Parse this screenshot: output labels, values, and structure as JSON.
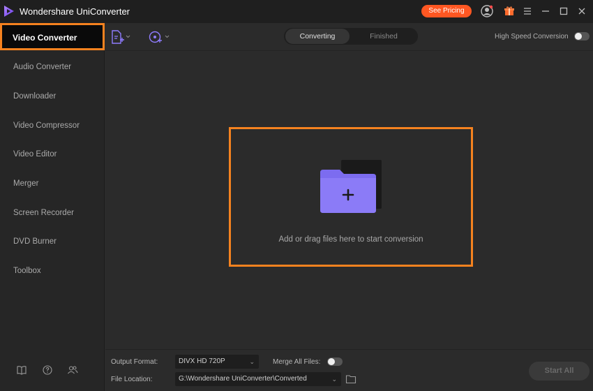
{
  "app": {
    "title": "Wondershare UniConverter",
    "see_pricing": "See Pricing"
  },
  "sidebar": {
    "items": [
      {
        "label": "Video Converter"
      },
      {
        "label": "Audio Converter"
      },
      {
        "label": "Downloader"
      },
      {
        "label": "Video Compressor"
      },
      {
        "label": "Video Editor"
      },
      {
        "label": "Merger"
      },
      {
        "label": "Screen Recorder"
      },
      {
        "label": "DVD Burner"
      },
      {
        "label": "Toolbox"
      }
    ],
    "bottom_icons": [
      "book-icon",
      "help-icon",
      "users-icon"
    ]
  },
  "toolbar": {
    "tabs": [
      {
        "label": "Converting"
      },
      {
        "label": "Finished"
      }
    ],
    "active_tab": "Converting",
    "high_speed_label": "High Speed Conversion",
    "high_speed_on": false
  },
  "dropzone": {
    "text": "Add or drag files here to start conversion"
  },
  "bottom": {
    "output_format_label": "Output Format:",
    "output_format_value": "DIVX HD 720P",
    "merge_label": "Merge All Files:",
    "merge_on": false,
    "file_location_label": "File Location:",
    "file_location_value": "G:\\Wondershare UniConverter\\Converted",
    "start_all": "Start All"
  },
  "colors": {
    "accent": "#f5821f",
    "pricing": "#ff5722",
    "folder": "#7c6cf0"
  }
}
